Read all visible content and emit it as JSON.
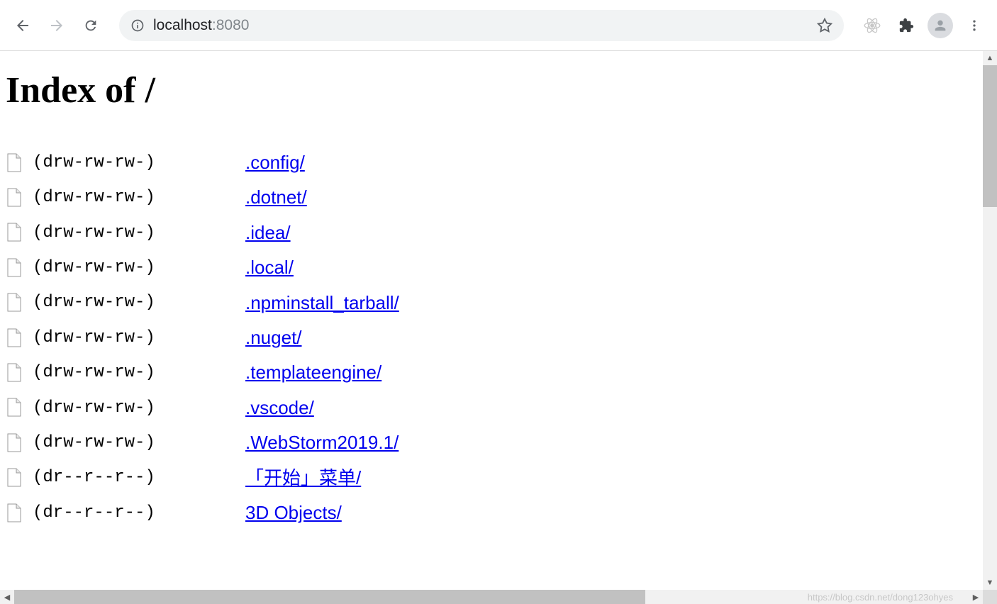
{
  "browser": {
    "url_host": "localhost",
    "url_port": ":8080"
  },
  "page": {
    "title": "Index of /"
  },
  "entries": [
    {
      "perms": "(drw-rw-rw-)",
      "name": ".config/"
    },
    {
      "perms": "(drw-rw-rw-)",
      "name": ".dotnet/"
    },
    {
      "perms": "(drw-rw-rw-)",
      "name": ".idea/"
    },
    {
      "perms": "(drw-rw-rw-)",
      "name": ".local/"
    },
    {
      "perms": "(drw-rw-rw-)",
      "name": ".npminstall_tarball/"
    },
    {
      "perms": "(drw-rw-rw-)",
      "name": ".nuget/"
    },
    {
      "perms": "(drw-rw-rw-)",
      "name": ".templateengine/"
    },
    {
      "perms": "(drw-rw-rw-)",
      "name": ".vscode/"
    },
    {
      "perms": "(drw-rw-rw-)",
      "name": ".WebStorm2019.1/"
    },
    {
      "perms": "(dr--r--r--)",
      "name": "「开始」菜单/"
    },
    {
      "perms": "(dr--r--r--)",
      "name": "3D Objects/"
    }
  ],
  "watermark": "https://blog.csdn.net/dong123ohyes"
}
